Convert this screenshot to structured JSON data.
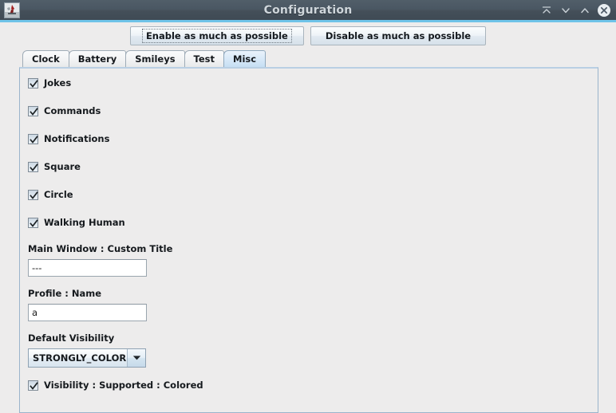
{
  "window": {
    "title": "Configuration",
    "icon": "app-icon",
    "controls": [
      {
        "name": "shade-button",
        "icon": "shade-icon"
      },
      {
        "name": "minimize-button",
        "icon": "chevron-down-icon"
      },
      {
        "name": "maximize-button",
        "icon": "chevron-up-icon"
      },
      {
        "name": "close-button",
        "icon": "close-circle-icon"
      }
    ]
  },
  "toolbar": {
    "enable_label": "Enable as much as possible",
    "disable_label": "Disable as much as possible"
  },
  "tabs": [
    {
      "label": "Clock",
      "selected": false
    },
    {
      "label": "Battery",
      "selected": false
    },
    {
      "label": "Smileys",
      "selected": false
    },
    {
      "label": "Test",
      "selected": false
    },
    {
      "label": "Misc",
      "selected": true
    }
  ],
  "misc": {
    "checkboxes": [
      {
        "label": "Jokes",
        "checked": true
      },
      {
        "label": "Commands",
        "checked": true
      },
      {
        "label": "Notifications",
        "checked": true
      },
      {
        "label": "Square",
        "checked": true
      },
      {
        "label": "Circle",
        "checked": true
      },
      {
        "label": "Walking Human",
        "checked": true
      }
    ],
    "custom_title": {
      "label": "Main Window : Custom Title",
      "value": "---",
      "placeholder": ""
    },
    "profile_name": {
      "label": "Profile : Name",
      "value": "a",
      "placeholder": ""
    },
    "default_visibility": {
      "label": "Default Visibility",
      "value": "STRONGLY_COLOR...",
      "arrow_icon": "chevron-down-icon"
    },
    "visibility_supported": {
      "label": "Visibility : Supported : Colored",
      "checked": true
    }
  },
  "colors": {
    "titlebar_dark": "#4a5763",
    "titlebar_accent": "#6fc3e8",
    "panel_bg": "#edecec",
    "panel_border": "#9ab4cc",
    "tab_selected": "#d6e8f7"
  }
}
